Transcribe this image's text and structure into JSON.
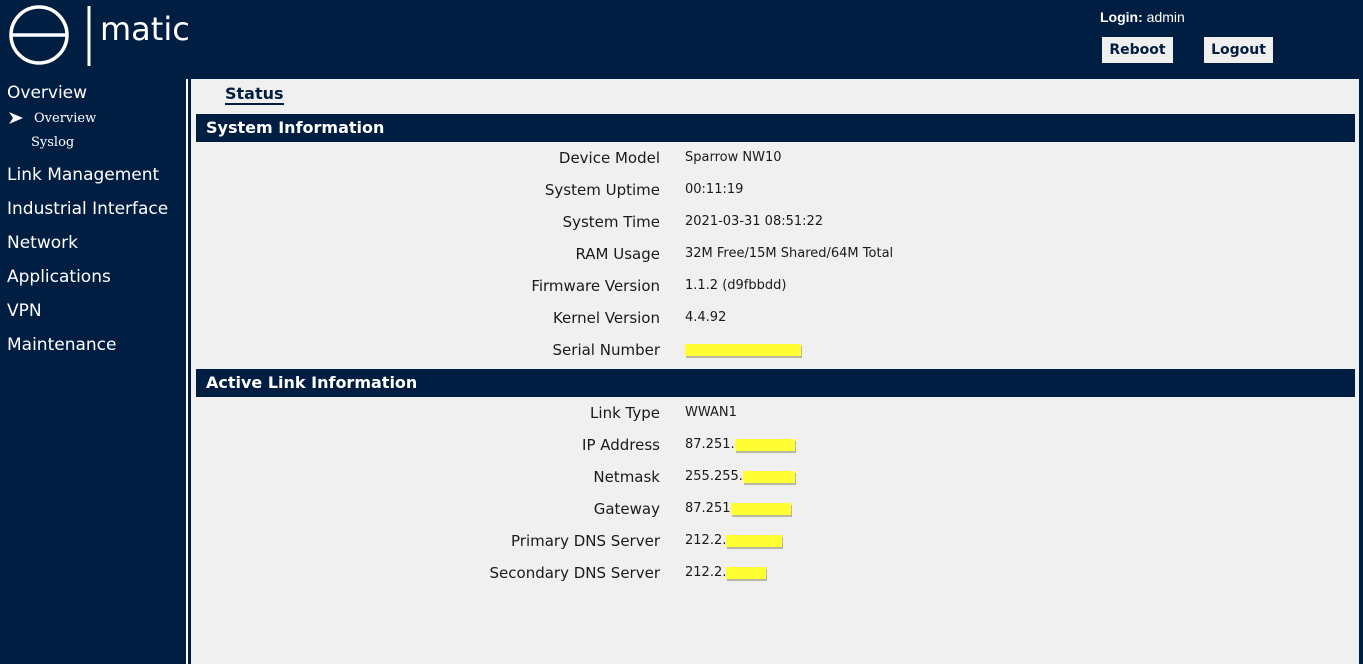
{
  "header": {
    "logo_text": "matic",
    "login_label": "Login:",
    "login_user": "admin",
    "reboot_label": "Reboot",
    "logout_label": "Logout"
  },
  "sidebar": {
    "items": [
      {
        "label": "Overview"
      },
      {
        "label": "Link Management"
      },
      {
        "label": "Industrial Interface"
      },
      {
        "label": "Network"
      },
      {
        "label": "Applications"
      },
      {
        "label": "VPN"
      },
      {
        "label": "Maintenance"
      }
    ],
    "sub_items": [
      {
        "label": "Overview",
        "active": true
      },
      {
        "label": "Syslog",
        "active": false
      }
    ]
  },
  "main": {
    "page_title": "Status",
    "system_info": {
      "title": "System Information",
      "rows": [
        {
          "label": "Device Model",
          "value": "Sparrow NW10"
        },
        {
          "label": "System Uptime",
          "value": "00:11:19"
        },
        {
          "label": "System Time",
          "value": "2021-03-31 08:51:22"
        },
        {
          "label": "RAM Usage",
          "value": "32M Free/15M Shared/64M Total"
        },
        {
          "label": "Firmware Version",
          "value": "1.1.2 (d9fbbdd)"
        },
        {
          "label": "Kernel Version",
          "value": "4.4.92"
        },
        {
          "label": "Serial Number",
          "value": ""
        }
      ]
    },
    "link_info": {
      "title": "Active Link Information",
      "rows": [
        {
          "label": "Link Type",
          "value": "WWAN1"
        },
        {
          "label": "IP Address",
          "value": "87.251."
        },
        {
          "label": "Netmask",
          "value": "255.255."
        },
        {
          "label": "Gateway",
          "value": "87.251"
        },
        {
          "label": "Primary DNS Server",
          "value": "212.2."
        },
        {
          "label": "Secondary DNS Server",
          "value": "212.2."
        }
      ]
    }
  },
  "colors": {
    "navy": "#001d42",
    "content_bg": "#eff0ef",
    "redaction": "#ffff33"
  }
}
